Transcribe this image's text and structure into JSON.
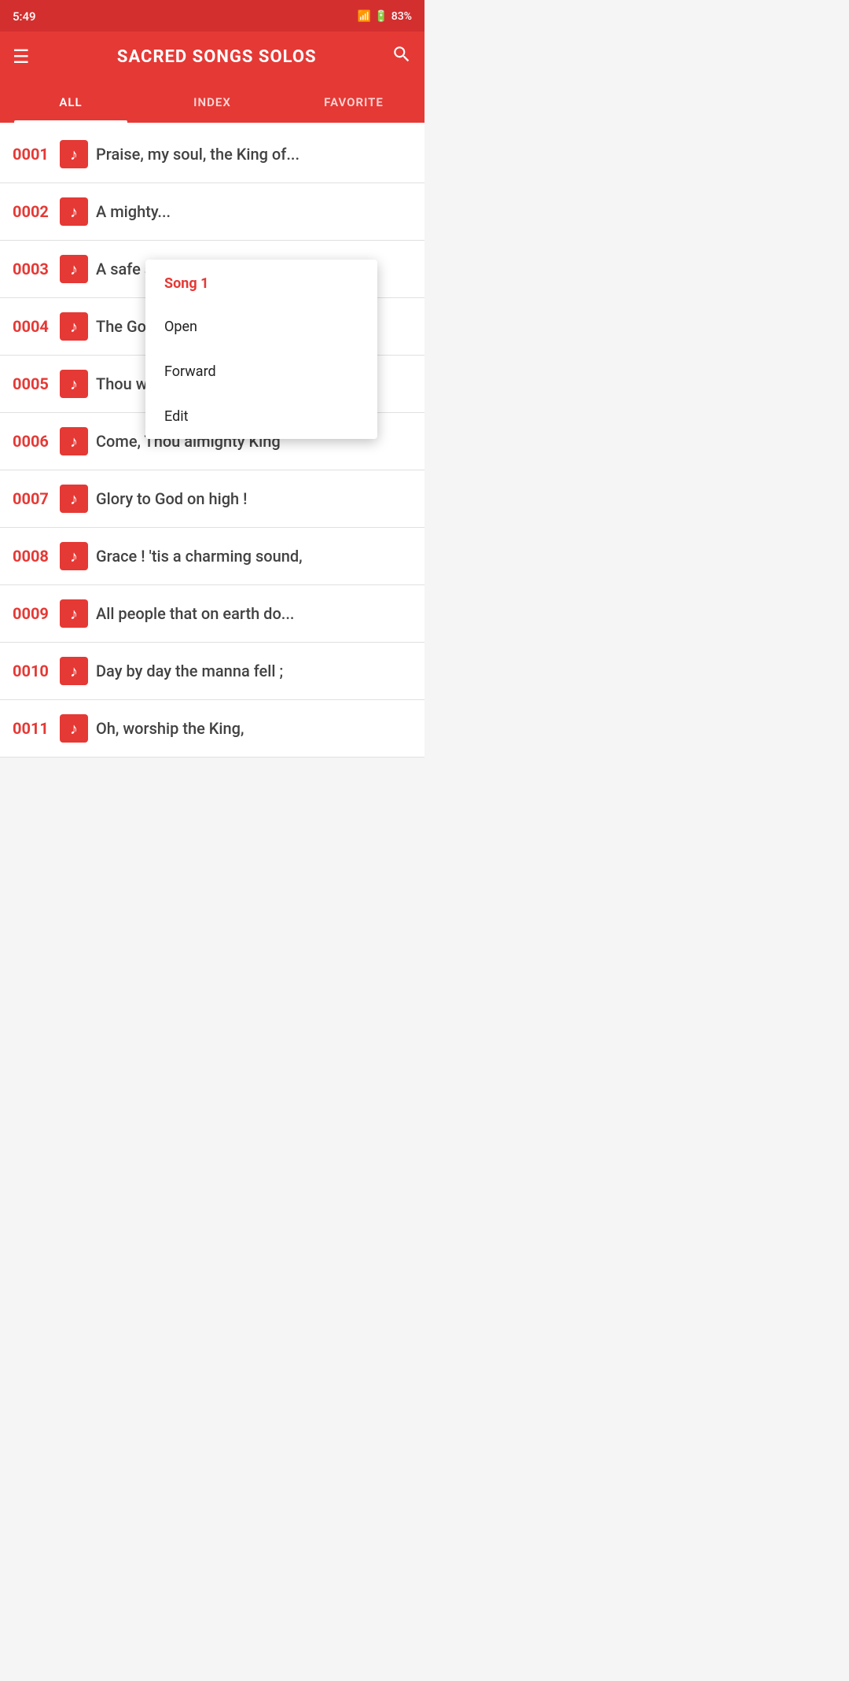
{
  "statusBar": {
    "time": "5:49",
    "battery": "83%",
    "batteryIcon": "🔋",
    "signalIcon": "📶"
  },
  "toolbar": {
    "title": "SACRED SONGS SOLOS",
    "menuIcon": "≡",
    "searchIcon": "🔍"
  },
  "tabs": [
    {
      "label": "ALL",
      "active": true
    },
    {
      "label": "INDEX",
      "active": false
    },
    {
      "label": "FAVORITE",
      "active": false
    }
  ],
  "songs": [
    {
      "number": "0001",
      "title": "Praise, my soul, the King of..."
    },
    {
      "number": "0002",
      "title": "A mighty..."
    },
    {
      "number": "0003",
      "title": "A safe st..."
    },
    {
      "number": "0004",
      "title": "The God..."
    },
    {
      "number": "0005",
      "title": "Thou wh..."
    },
    {
      "number": "0006",
      "title": "Come, Thou almighty King"
    },
    {
      "number": "0007",
      "title": "Glory to God on high !"
    },
    {
      "number": "0008",
      "title": "Grace ! 'tis a charming sound,"
    },
    {
      "number": "0009",
      "title": "All people that on earth do..."
    },
    {
      "number": "0010",
      "title": "Day by day the manna fell ;"
    },
    {
      "number": "0011",
      "title": "Oh, worship the King,"
    }
  ],
  "contextMenu": {
    "title": "Song 1",
    "items": [
      {
        "label": "Open"
      },
      {
        "label": "Forward"
      },
      {
        "label": "Edit"
      }
    ]
  },
  "colors": {
    "primary": "#e53935",
    "dark": "#d32f2f"
  }
}
